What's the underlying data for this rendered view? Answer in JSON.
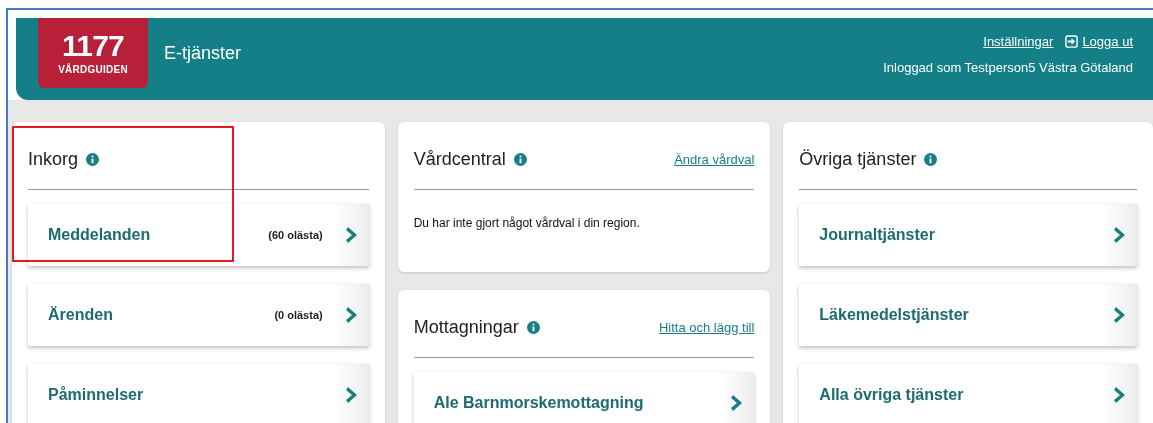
{
  "header": {
    "logo": {
      "number": "1177",
      "name": "VÅRDGUIDEN"
    },
    "title": "E-tjänster",
    "links": [
      {
        "label": "Inställningar",
        "kind": "plain"
      },
      {
        "label": "Logga ut",
        "kind": "logout"
      }
    ],
    "user_line": "Inloggad som Testperson5 Västra Götaland"
  },
  "columns": [
    {
      "cards": [
        {
          "title": "Inkorg",
          "highlighted": true,
          "items": [
            {
              "label": "Meddelanden",
              "count": "(60 olästa)"
            },
            {
              "label": "Ärenden",
              "count": "(0 olästa)"
            },
            {
              "label": "Påminnelser"
            }
          ]
        }
      ]
    },
    {
      "cards": [
        {
          "title": "Vårdcentral",
          "highlighted": false,
          "action": "Ändra vårdval",
          "text": "Du har inte gjort något vårdval i din region."
        },
        {
          "title": "Mottagningar",
          "highlighted": false,
          "action": "Hitta och lägg till",
          "items": [
            {
              "label": "Ale Barnmorskemottagning"
            }
          ]
        }
      ]
    },
    {
      "cards": [
        {
          "title": "Övriga tjänster",
          "highlighted": false,
          "items": [
            {
              "label": "Journaltjänster"
            },
            {
              "label": "Läkemedelstjänster"
            },
            {
              "label": "Alla övriga tjänster"
            }
          ]
        }
      ]
    }
  ]
}
